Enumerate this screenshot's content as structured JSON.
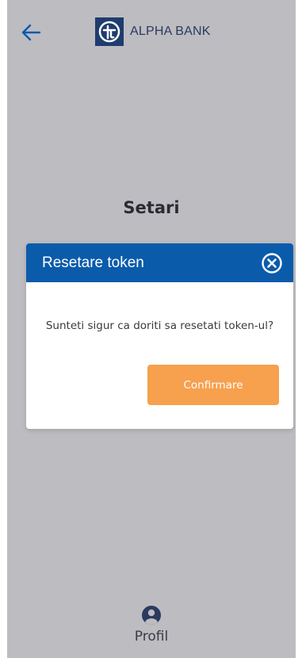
{
  "header": {
    "back_icon": "arrow-left-icon",
    "bank_name": "ALPHA BANK",
    "logo_icon": "alpha-bank-logo",
    "accent_color": "#0b5bab"
  },
  "page": {
    "title": "Setari"
  },
  "modal": {
    "title": "Resetare token",
    "close_icon": "close-circle-icon",
    "message": "Sunteti sigur ca doriti sa resetati token-ul?",
    "confirm_label": "Confirmare",
    "header_color": "#0b5bab",
    "confirm_color": "#f7a04e"
  },
  "bottom_nav": {
    "profile_icon": "user-circle-icon",
    "profile_label": "Profil"
  }
}
